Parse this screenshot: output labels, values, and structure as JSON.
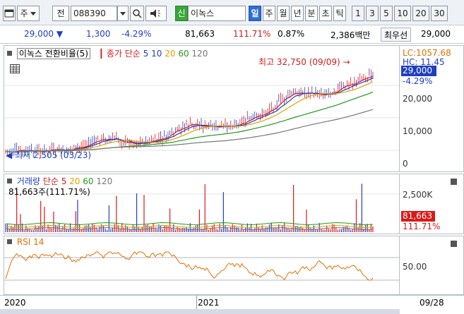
{
  "toolbar": {
    "market_label": "주",
    "all_label": "전",
    "code": "088390",
    "stock_badge": "신",
    "stock_name": "이녹스",
    "period_tabs": [
      "일",
      "주",
      "월",
      "년",
      "분",
      "초",
      "틱"
    ],
    "active_period": "일",
    "intervals": [
      "1",
      "3",
      "5",
      "10",
      "20",
      "30"
    ]
  },
  "quote": {
    "price": "29,000",
    "change": "1,300",
    "change_pct": "-4.29%",
    "volume": "81,663",
    "volume_ratio": "111.71%",
    "turnover": "0.87%",
    "amount": "2,386백만",
    "priority_label": "최우선",
    "priority_price": "29,000"
  },
  "price_pane": {
    "title": "이녹스 전환비율(5)",
    "ma_label": "종가 단순",
    "ma_periods": [
      {
        "label": "5",
        "color": "#1f3fbf"
      },
      {
        "label": "10",
        "color": "#1f3fbf"
      },
      {
        "label": "20",
        "color": "#e0a000"
      },
      {
        "label": "60",
        "color": "#1f9a1f"
      },
      {
        "label": "120",
        "color": "#777777"
      }
    ],
    "high_label": "최고 32,750 (09/09)",
    "low_label": "최저 2,505 (03/23)",
    "lc": "LC:1057.68",
    "hc": "HC: 11.45",
    "price_tag": "29,000",
    "price_tag_pct": "-4.29%",
    "y_ticks": [
      "20,000",
      "10,000",
      "0"
    ]
  },
  "volume_pane": {
    "title": "거래량",
    "ma_label": "단순",
    "ma_periods": [
      {
        "label": "5",
        "color": "#d81a1a"
      },
      {
        "label": "20",
        "color": "#e0a000"
      },
      {
        "label": "60",
        "color": "#1f9a1f"
      },
      {
        "label": "120",
        "color": "#777777"
      }
    ],
    "current": "81,663주(111.71%)",
    "y_ticks": [
      "2,500K"
    ],
    "vol_tag": "81,663",
    "vol_tag_pct": "111.71%"
  },
  "rsi_pane": {
    "title": "RSI 14",
    "y_ticks": [
      "50.00"
    ]
  },
  "x_axis": {
    "labels": [
      "2020",
      "2021"
    ],
    "right_date": "09/28"
  },
  "colors": {
    "up": "#d81a1a",
    "down": "#1f3fbf",
    "accent": "#2d6fd2"
  }
}
